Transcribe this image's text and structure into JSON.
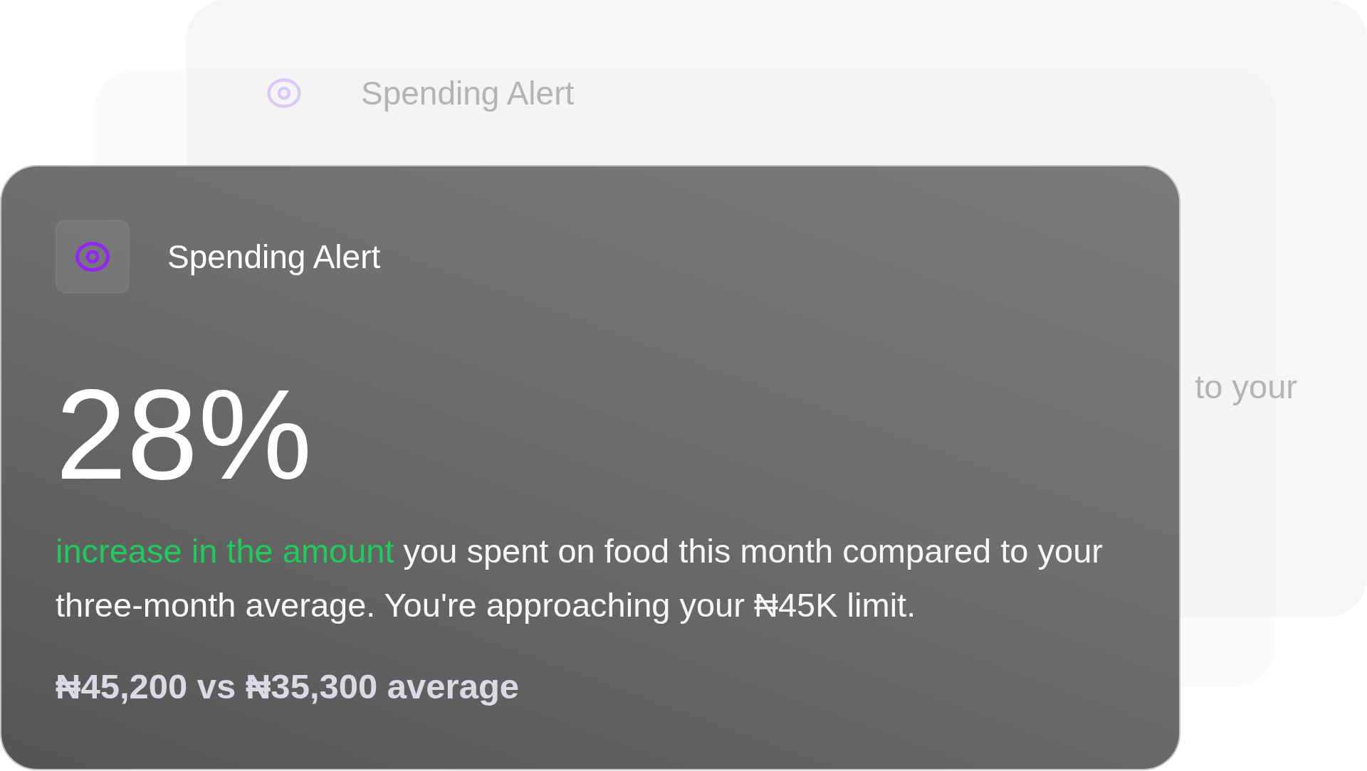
{
  "background_card": {
    "title": "Spending Alert",
    "text_fragment": "to your"
  },
  "alert_card": {
    "title": "Spending Alert",
    "percentage": "28%",
    "message_highlight": "increase in the amount",
    "message": "you spent on food this month compared to your three-month average. You're approaching your ₦45K limit.",
    "comparison": "₦45,200 vs ₦35,300 average"
  }
}
